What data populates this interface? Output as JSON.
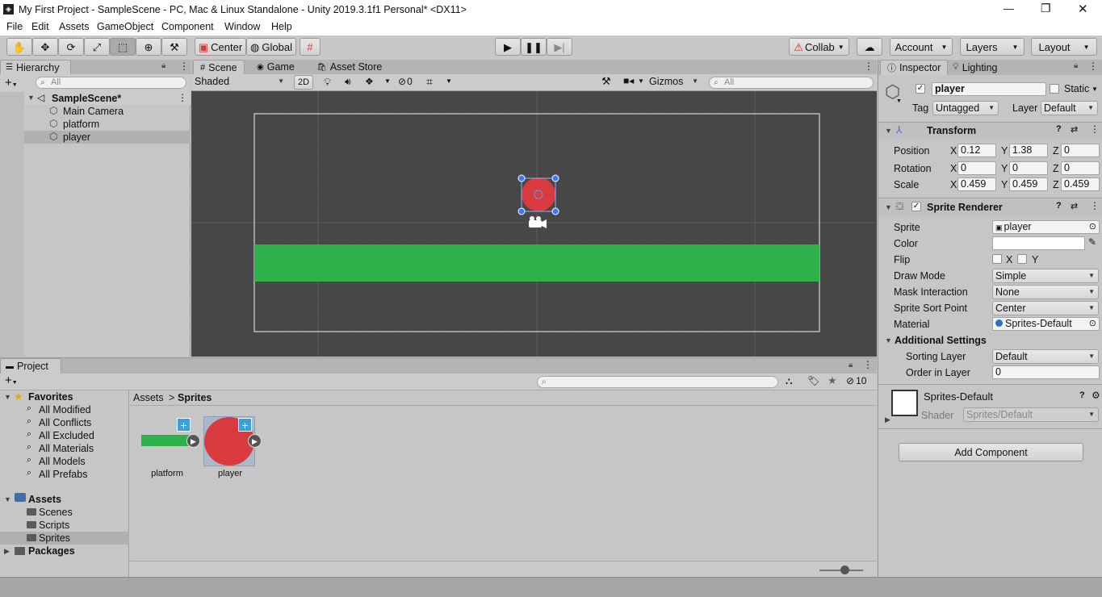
{
  "window": {
    "title": "My First Project - SampleScene - PC, Mac & Linux Standalone - Unity 2019.3.1f1 Personal* <DX11>",
    "minimize_glyph": "—",
    "maximize_glyph": "❐",
    "close_glyph": "✕"
  },
  "menu": [
    "File",
    "Edit",
    "Assets",
    "GameObject",
    "Component",
    "Window",
    "Help"
  ],
  "toolbar": {
    "pivot_label": "Center",
    "space_label": "Global",
    "collab_label": "Collab",
    "account_label": "Account",
    "layers_label": "Layers",
    "layout_label": "Layout"
  },
  "hierarchy": {
    "tab_label": "Hierarchy",
    "search_placeholder": "All",
    "scene_name": "SampleScene*",
    "items": [
      "Main Camera",
      "platform",
      "player"
    ]
  },
  "scene": {
    "tabs": [
      "Scene",
      "Game",
      "Asset Store"
    ],
    "shading_mode": "Shaded",
    "mode_2d": "2D",
    "hidden_count": "0",
    "gizmos_label": "Gizmos",
    "search_placeholder": "All",
    "colors": {
      "background": "#474747",
      "platform": "#2db24b",
      "player": "#d83a40",
      "selection": "#3b78ff"
    }
  },
  "project": {
    "tab_label": "Project",
    "hidden_count": "10",
    "favorites_label": "Favorites",
    "favorites": [
      "All Modified",
      "All Conflicts",
      "All Excluded",
      "All Materials",
      "All Models",
      "All Prefabs"
    ],
    "assets_label": "Assets",
    "asset_folders": [
      "Scenes",
      "Scripts",
      "Sprites"
    ],
    "packages_label": "Packages",
    "breadcrumb_root": "Assets",
    "breadcrumb_sep": ">",
    "breadcrumb_current": "Sprites",
    "assets": [
      {
        "name": "platform"
      },
      {
        "name": "player"
      }
    ]
  },
  "inspector": {
    "tabs": [
      "Inspector",
      "Lighting"
    ],
    "object_name": "player",
    "static_label": "Static",
    "tag_label": "Tag",
    "tag_value": "Untagged",
    "layer_label": "Layer",
    "layer_value": "Default",
    "transform": {
      "title": "Transform",
      "position_label": "Position",
      "rotation_label": "Rotation",
      "scale_label": "Scale",
      "axis_x": "X",
      "axis_y": "Y",
      "axis_z": "Z",
      "position": {
        "x": "0.12",
        "y": "1.38",
        "z": "0"
      },
      "rotation": {
        "x": "0",
        "y": "0",
        "z": "0"
      },
      "scale": {
        "x": "0.459",
        "y": "0.459",
        "z": "0.459"
      }
    },
    "sprite_renderer": {
      "title": "Sprite Renderer",
      "sprite_label": "Sprite",
      "sprite_value": "player",
      "color_label": "Color",
      "flip_label": "Flip",
      "flip_x": "X",
      "flip_y": "Y",
      "draw_mode_label": "Draw Mode",
      "draw_mode_value": "Simple",
      "mask_label": "Mask Interaction",
      "mask_value": "None",
      "sort_point_label": "Sprite Sort Point",
      "sort_point_value": "Center",
      "material_label": "Material",
      "material_value": "Sprites-Default",
      "additional_label": "Additional Settings",
      "sorting_layer_label": "Sorting Layer",
      "sorting_layer_value": "Default",
      "order_label": "Order in Layer",
      "order_value": "0"
    },
    "material": {
      "name": "Sprites-Default",
      "shader_label": "Shader",
      "shader_value": "Sprites/Default"
    },
    "add_component_label": "Add Component"
  }
}
